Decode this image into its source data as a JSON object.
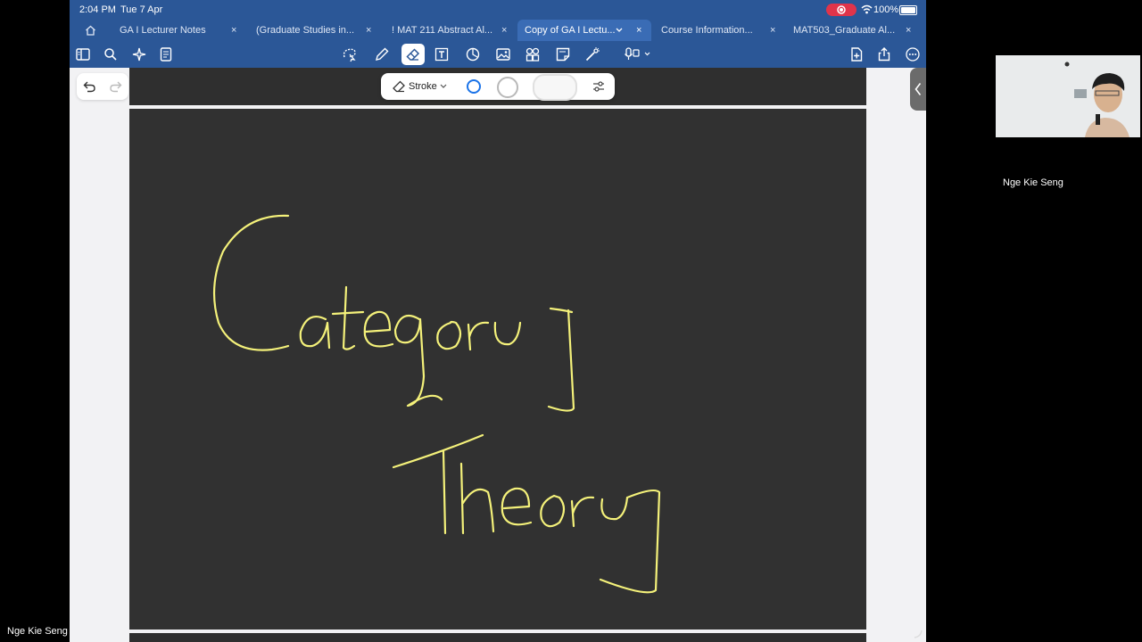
{
  "status_bar": {
    "time": "2:04 PM",
    "date": "Tue 7 Apr",
    "battery": "100%"
  },
  "tabs": [
    {
      "label": "GA I Lecturer Notes"
    },
    {
      "label": "(Graduate Studies in..."
    },
    {
      "label": "! MAT 211 Abstract Al..."
    },
    {
      "label": "Copy of GA I Lectu..."
    },
    {
      "label": "Course Information..."
    },
    {
      "label": "MAT503_Graduate Al..."
    }
  ],
  "tab_close_glyph": "×",
  "stroke_toolbar": {
    "mode_label": "Stroke",
    "selected_color": "#1a73e8"
  },
  "ink": {
    "color": "#f4f17a",
    "line1": "Category",
    "line2": "Theory"
  },
  "participant": {
    "name": "Nge Kie Seng"
  },
  "colors": {
    "ribbon": "#2b5797",
    "page": "#313131",
    "recording": "#e0344a"
  }
}
